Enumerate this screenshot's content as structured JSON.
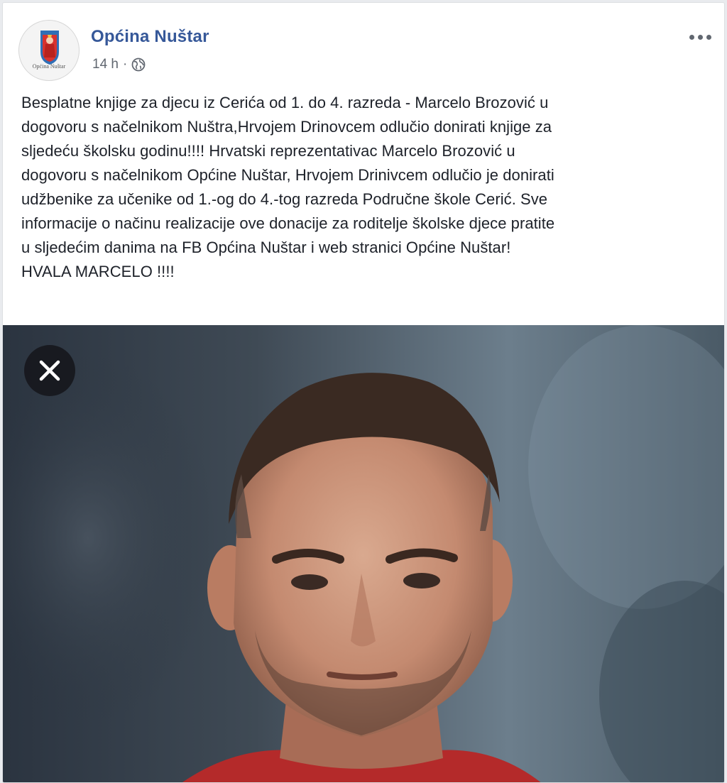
{
  "post": {
    "page_name": "Općina Nuštar",
    "timestamp": "14 h",
    "separator": "·",
    "privacy_icon": "globe-icon",
    "more_icon": "more-options-icon",
    "avatar_logo_text": "Općina Nuštar",
    "text_lines": [
      "Besplatne knjige za djecu iz Cerića od 1. do 4. razreda - Marcelo Brozović u",
      "dogovoru s načelnikom Nuštra,Hrvojem Drinovcem odlučio donirati knjige za",
      "sljedeću školsku godinu!!!! Hrvatski reprezentativac Marcelo Brozović u",
      "dogovoru s načelnikom Općine Nuštar, Hrvojem Drinivcem odlučio je donirati",
      "udžbenike za učenike od 1.-og do 4.-tog razreda Područne škole Cerić. Sve",
      "informacije o načinu realizacije ove donacije za roditelje školske djece pratite",
      "u sljedećim danima na FB Općina Nuštar i web stranici Općine Nuštar!",
      "HVALA MARCELO !!!!"
    ],
    "close_icon": "close-icon"
  },
  "colors": {
    "page_name": "#365899",
    "text": "#1d2129",
    "meta": "#616770",
    "background": "#e9ebee"
  }
}
